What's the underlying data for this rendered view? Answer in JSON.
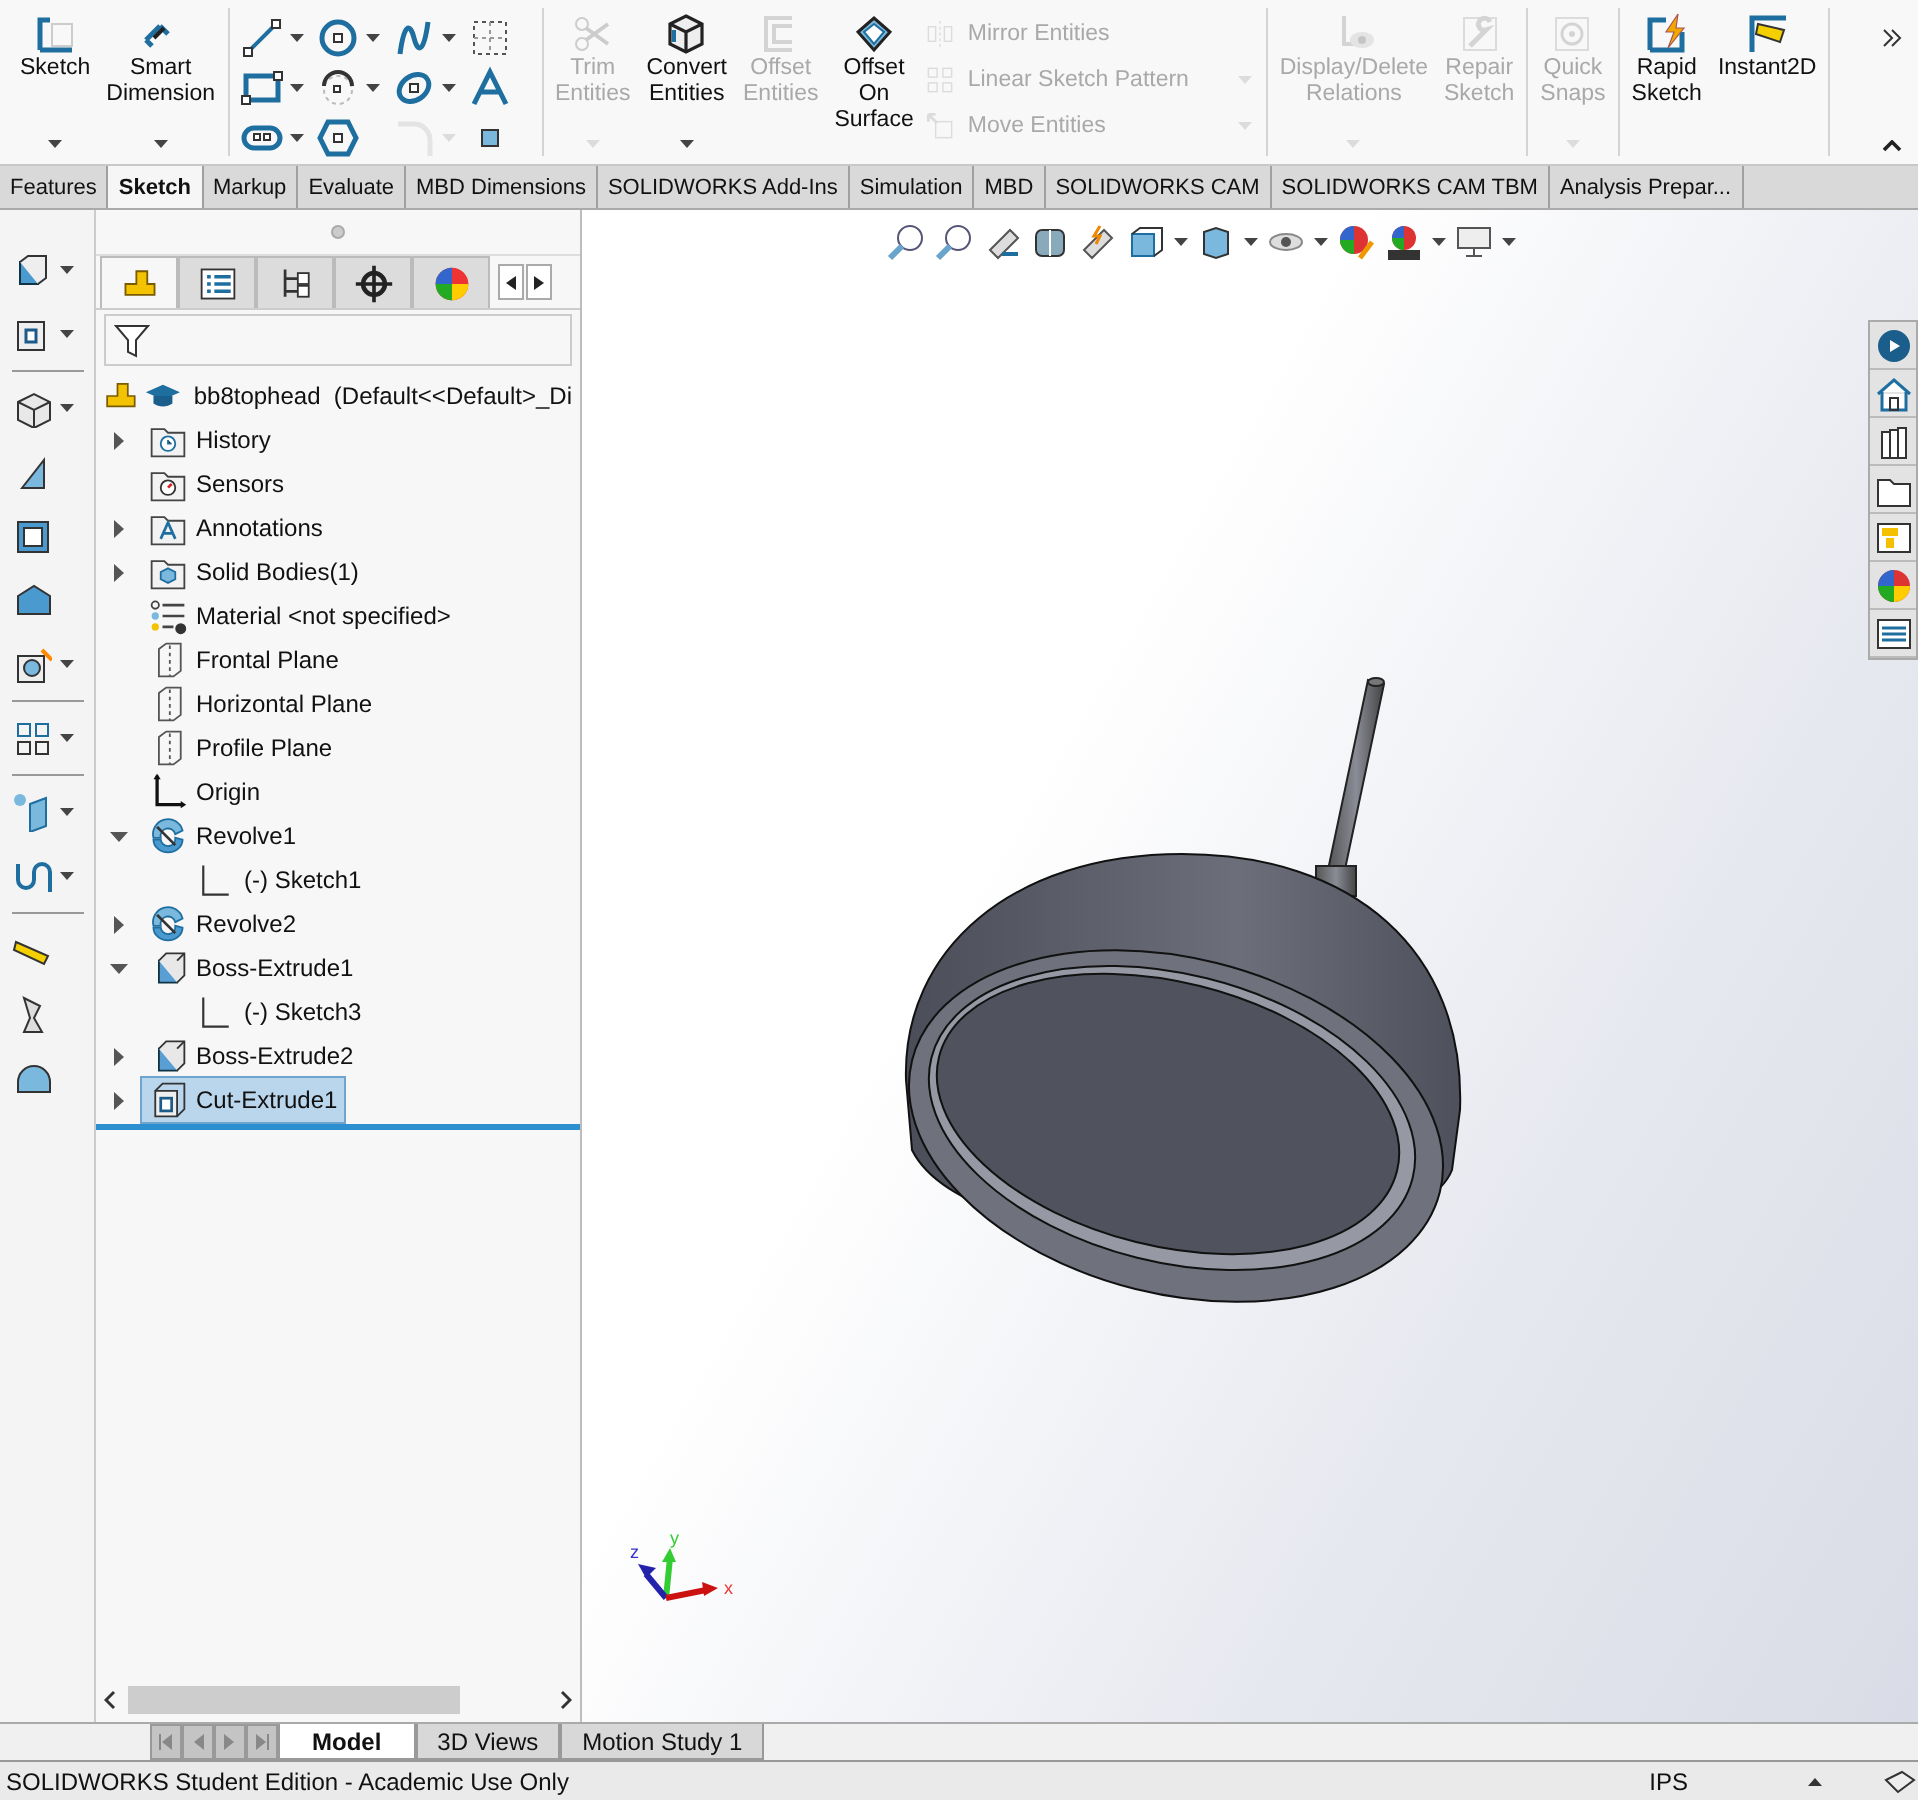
{
  "ribbon": {
    "groups": [
      {
        "kind": "buttons",
        "buttons": [
          {
            "label": "Sketch",
            "kind": "large",
            "disabled": false,
            "dropdown": true
          },
          {
            "label": "Smart Dimension",
            "kind": "large",
            "disabled": false,
            "dropdown": true
          }
        ]
      },
      {
        "kind": "tools",
        "tools": [
          {
            "dropdown": true,
            "disabled": false
          },
          {
            "dropdown": true,
            "disabled": false
          },
          {
            "dropdown": true,
            "disabled": false
          },
          {
            "dropdown": false,
            "disabled": false
          },
          {
            "dropdown": true,
            "disabled": false
          },
          {
            "dropdown": true,
            "disabled": false
          },
          {
            "dropdown": true,
            "disabled": false
          },
          {
            "dropdown": false,
            "disabled": false
          },
          {
            "dropdown": true,
            "disabled": false
          },
          {
            "dropdown": false,
            "disabled": false
          },
          {
            "dropdown": true,
            "disabled": true
          },
          {
            "dropdown": false,
            "disabled": false
          }
        ]
      },
      {
        "kind": "buttons",
        "buttons": [
          {
            "label": "Trim Entities",
            "kind": "large",
            "disabled": true,
            "dropdown": true
          },
          {
            "label": "Convert Entities",
            "kind": "large",
            "disabled": false,
            "dropdown": true
          },
          {
            "label": "Offset Entities",
            "kind": "large",
            "disabled": true,
            "dropdown": false
          },
          {
            "label": "Offset On Surface",
            "kind": "large",
            "disabled": false,
            "dropdown": false
          },
          {
            "label": "Mirror Entities",
            "kind": "small",
            "disabled": true,
            "dropdown": false
          },
          {
            "label": "Linear Sketch Pattern",
            "kind": "small",
            "disabled": true,
            "dropdown": true
          },
          {
            "label": "Move Entities",
            "kind": "small",
            "disabled": true,
            "dropdown": true
          }
        ]
      },
      {
        "kind": "buttons",
        "buttons": [
          {
            "label": "Display/Delete Relations",
            "kind": "large",
            "disabled": true,
            "dropdown": true
          },
          {
            "label": "Repair Sketch",
            "kind": "large",
            "disabled": true,
            "dropdown": false
          }
        ]
      },
      {
        "kind": "buttons",
        "buttons": [
          {
            "label": "Quick Snaps",
            "kind": "large",
            "disabled": true,
            "dropdown": true
          }
        ]
      },
      {
        "kind": "buttons",
        "buttons": [
          {
            "label": "Rapid Sketch",
            "kind": "large",
            "disabled": false,
            "dropdown": false
          },
          {
            "label": "Instant2D",
            "kind": "large",
            "disabled": false,
            "dropdown": false
          }
        ]
      }
    ]
  },
  "command_tabs": [
    {
      "label": "Features",
      "selected": false
    },
    {
      "label": "Sketch",
      "selected": true
    },
    {
      "label": "Markup",
      "selected": false
    },
    {
      "label": "Evaluate",
      "selected": false
    },
    {
      "label": "MBD Dimensions",
      "selected": false
    },
    {
      "label": "SOLIDWORKS Add-Ins",
      "selected": false
    },
    {
      "label": "Simulation",
      "selected": false
    },
    {
      "label": "MBD",
      "selected": false
    },
    {
      "label": "SOLIDWORKS CAM",
      "selected": false
    },
    {
      "label": "SOLIDWORKS CAM TBM",
      "selected": false
    },
    {
      "label": "Analysis Prepar...",
      "selected": false
    }
  ],
  "panel_tabs": [
    {
      "selected": true
    },
    {
      "selected": false
    },
    {
      "selected": false
    },
    {
      "selected": false
    },
    {
      "selected": false
    }
  ],
  "feature_tree": {
    "root": "bb8tophead  (Default<<Default>_Di",
    "items": [
      {
        "label": "History",
        "kind": "history",
        "expanded": false,
        "selected": false
      },
      {
        "label": "Sensors",
        "kind": "sensors",
        "selected": false
      },
      {
        "label": "Annotations",
        "kind": "annotations",
        "expanded": false,
        "selected": false
      },
      {
        "label": "Solid Bodies(1)",
        "kind": "bodies",
        "expanded": false,
        "selected": false
      },
      {
        "label": "Material <not specified>",
        "kind": "material",
        "selected": false
      },
      {
        "label": "Frontal Plane",
        "kind": "plane",
        "selected": false
      },
      {
        "label": "Horizontal Plane",
        "kind": "plane",
        "selected": false
      },
      {
        "label": "Profile Plane",
        "kind": "plane",
        "selected": false
      },
      {
        "label": "Origin",
        "kind": "origin",
        "selected": false
      },
      {
        "label": "Revolve1",
        "kind": "revolve",
        "expanded": true,
        "selected": false,
        "children": [
          {
            "label": "(-) Sketch1",
            "kind": "sketch",
            "selected": false
          }
        ]
      },
      {
        "label": "Revolve2",
        "kind": "revolve",
        "expanded": false,
        "selected": false
      },
      {
        "label": "Boss-Extrude1",
        "kind": "extrude",
        "expanded": true,
        "selected": false,
        "children": [
          {
            "label": "(-) Sketch3",
            "kind": "sketch",
            "selected": false
          }
        ]
      },
      {
        "label": "Boss-Extrude2",
        "kind": "extrude",
        "expanded": false,
        "selected": false
      },
      {
        "label": "Cut-Extrude1",
        "kind": "cut",
        "expanded": false,
        "selected": true
      }
    ]
  },
  "viewport": {
    "triad": {
      "x": "x",
      "y": "y",
      "z": "z"
    }
  },
  "bottom_tabs": [
    {
      "label": "Model",
      "selected": true
    },
    {
      "label": "3D Views",
      "selected": false
    },
    {
      "label": "Motion Study 1",
      "selected": false
    }
  ],
  "status_bar": {
    "message": "SOLIDWORKS Student Edition - Academic Use Only",
    "units": "IPS"
  }
}
